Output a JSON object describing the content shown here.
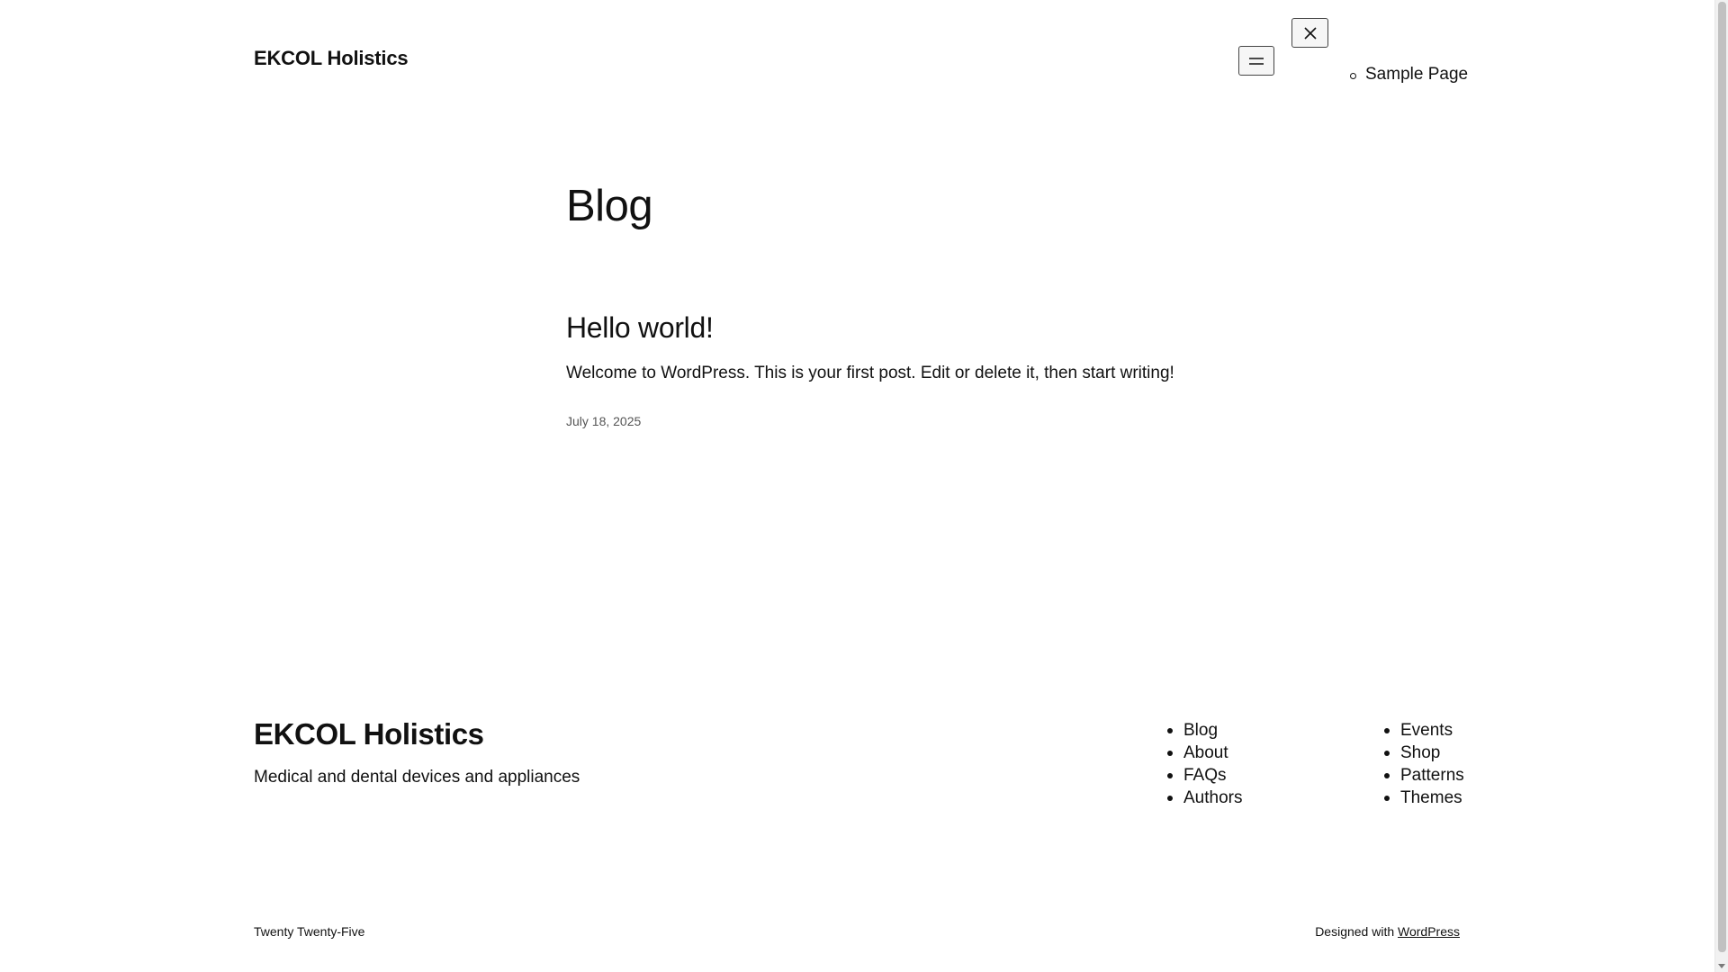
{
  "header": {
    "site_title": "EKCOL Holistics",
    "menu_open_icon": "hamburger-icon",
    "menu_close_icon": "close-icon",
    "overlay_menu": {
      "items": [
        {
          "label": "Sample Page"
        }
      ]
    }
  },
  "main": {
    "page_title": "Blog",
    "posts": [
      {
        "title": "Hello world!",
        "excerpt": "Welcome to WordPress. This is your first post. Edit or delete it, then start writing!",
        "date": "July 18, 2025"
      }
    ]
  },
  "footer": {
    "site_title": "EKCOL Holistics",
    "tagline": "Medical and dental devices and appliances",
    "nav_col1": [
      "Blog",
      "About",
      "FAQs",
      "Authors"
    ],
    "nav_col2": [
      "Events",
      "Shop",
      "Patterns",
      "Themes"
    ],
    "credit_left": "Twenty Twenty-Five",
    "credit_right_prefix": "Designed with",
    "credit_right_link": "WordPress"
  },
  "colors": {
    "text": "#111111",
    "muted": "#555555",
    "background": "#ffffff"
  }
}
